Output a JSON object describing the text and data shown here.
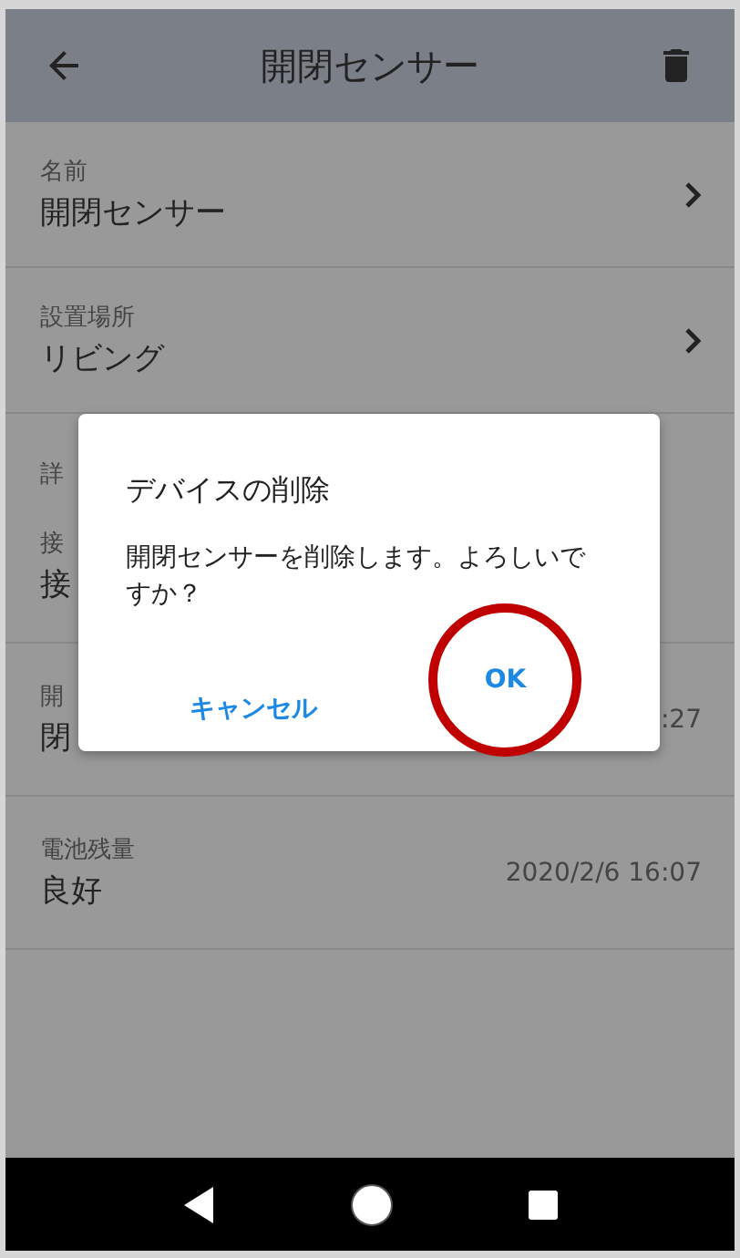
{
  "app_bar": {
    "title": "開閉センサー"
  },
  "rows": [
    {
      "label": "名前",
      "value": "開閉センサー",
      "kind": "link"
    },
    {
      "label": "設置場所",
      "value": "リビング",
      "kind": "link"
    }
  ],
  "section_title": "詳",
  "detail_rows": [
    {
      "label": "接",
      "value": "接"
    },
    {
      "label": "開",
      "value": "閉",
      "time": ":27"
    },
    {
      "label": "電池残量",
      "value": "良好",
      "time": "2020/2/6 16:07"
    }
  ],
  "dialog": {
    "title": "デバイスの削除",
    "message": "開閉センサーを削除します。よろしいですか？",
    "buttons": [
      {
        "label": "キャンセル",
        "highlighted": false
      },
      {
        "label": "OK",
        "highlighted": true
      }
    ]
  }
}
